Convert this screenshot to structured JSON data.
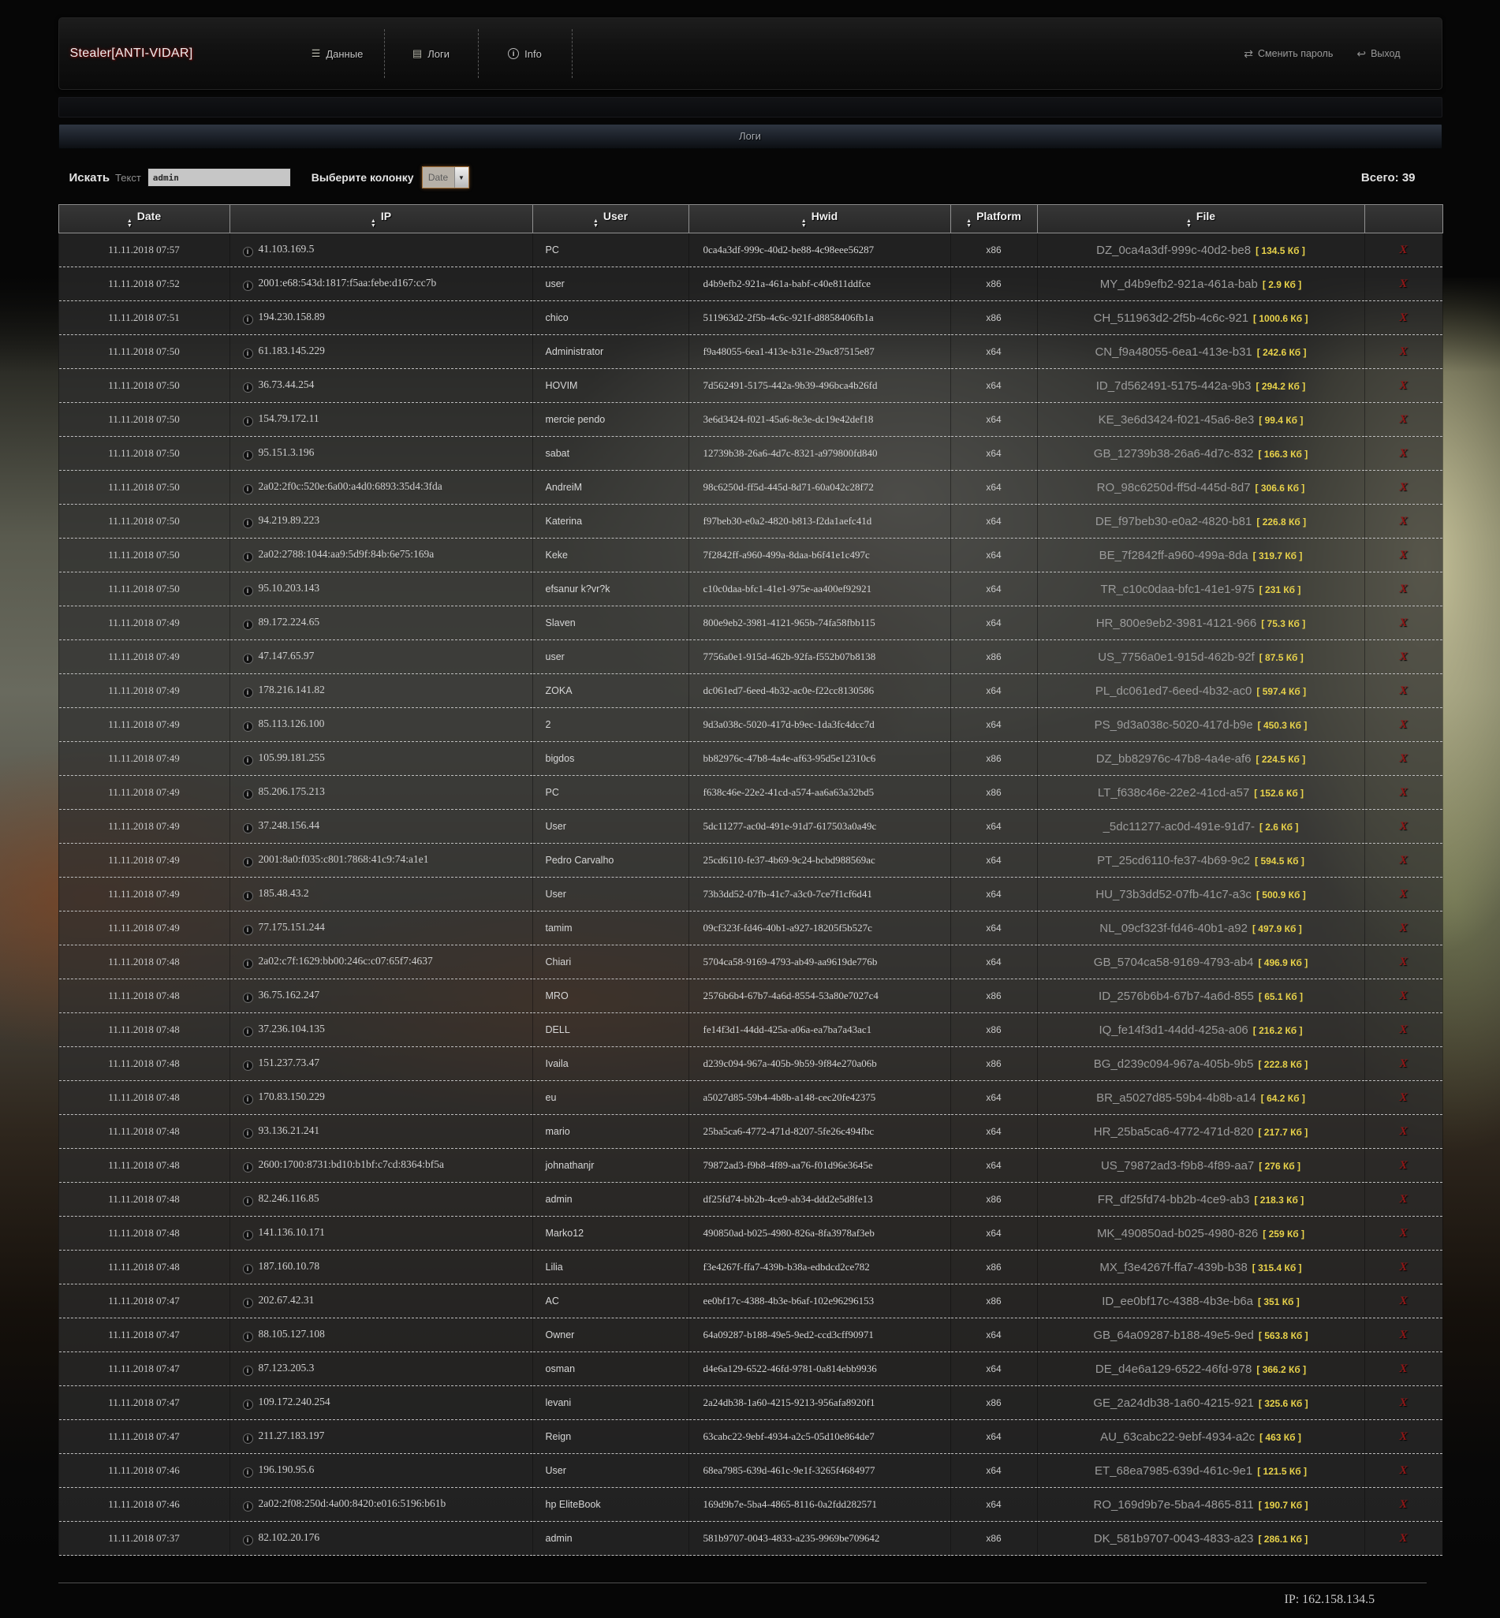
{
  "app": {
    "title": "Stealer[ANTI-VIDAR]"
  },
  "nav": {
    "items": [
      {
        "label": "Данные",
        "glyph": "☰",
        "icon": "data-menu-icon",
        "circle": false
      },
      {
        "label": "Логи",
        "glyph": "▤",
        "icon": "logs-icon",
        "circle": false
      },
      {
        "label": "Info",
        "glyph": "i",
        "icon": "info-icon",
        "circle": true
      }
    ]
  },
  "account": {
    "change_password": "Сменить пароль",
    "logout": "Выход",
    "change_password_glyph": "⇄",
    "logout_glyph": "↩"
  },
  "section": {
    "title": "Логи"
  },
  "search": {
    "label": "Искать",
    "text_label": "Текст",
    "value": "admin",
    "column_label": "Выберите колонку",
    "column_selected": "Date",
    "total_label": "Всего: 39"
  },
  "colors": {
    "title_glow": "#8a1111",
    "file_size_yellow": "#e8d24a",
    "delete_red": "#8f1717"
  },
  "footer": {
    "ip": "IP: 162.158.134.5"
  },
  "table": {
    "delete_glyph": "X",
    "columns": [
      {
        "key": "date",
        "label": "Date"
      },
      {
        "key": "ip",
        "label": "IP"
      },
      {
        "key": "user",
        "label": "User"
      },
      {
        "key": "hwid",
        "label": "Hwid"
      },
      {
        "key": "platform",
        "label": "Platform"
      },
      {
        "key": "file",
        "label": "File"
      }
    ],
    "rows": [
      {
        "date": "11.11.2018 07:57",
        "ip": "41.103.169.5",
        "user": "PC",
        "hwid": "0ca4a3df-999c-40d2-be88-4c98eee56287",
        "platform": "x86",
        "file": "DZ_0ca4a3df-999c-40d2-be8",
        "size": "134.5 Кб"
      },
      {
        "date": "11.11.2018 07:52",
        "ip": "2001:e68:543d:1817:f5aa:febe:d167:cc7b",
        "user": "user",
        "hwid": "d4b9efb2-921a-461a-babf-c40e811ddfce",
        "platform": "x86",
        "file": "MY_d4b9efb2-921a-461a-bab",
        "size": "2.9 Кб"
      },
      {
        "date": "11.11.2018 07:51",
        "ip": "194.230.158.89",
        "user": "chico",
        "hwid": "511963d2-2f5b-4c6c-921f-d8858406fb1a",
        "platform": "x86",
        "file": "CH_511963d2-2f5b-4c6c-921",
        "size": "1000.6 Кб"
      },
      {
        "date": "11.11.2018 07:50",
        "ip": "61.183.145.229",
        "user": "Administrator",
        "hwid": "f9a48055-6ea1-413e-b31e-29ac87515e87",
        "platform": "x64",
        "file": "CN_f9a48055-6ea1-413e-b31",
        "size": "242.6 Кб"
      },
      {
        "date": "11.11.2018 07:50",
        "ip": "36.73.44.254",
        "user": "HOVIM",
        "hwid": "7d562491-5175-442a-9b39-496bca4b26fd",
        "platform": "x64",
        "file": "ID_7d562491-5175-442a-9b3",
        "size": "294.2 Кб"
      },
      {
        "date": "11.11.2018 07:50",
        "ip": "154.79.172.11",
        "user": "mercie pendo",
        "hwid": "3e6d3424-f021-45a6-8e3e-dc19e42def18",
        "platform": "x64",
        "file": "KE_3e6d3424-f021-45a6-8e3",
        "size": "99.4 Кб"
      },
      {
        "date": "11.11.2018 07:50",
        "ip": "95.151.3.196",
        "user": "sabat",
        "hwid": "12739b38-26a6-4d7c-8321-a979800fd840",
        "platform": "x64",
        "file": "GB_12739b38-26a6-4d7c-832",
        "size": "166.3 Кб"
      },
      {
        "date": "11.11.2018 07:50",
        "ip": "2a02:2f0c:520e:6a00:a4d0:6893:35d4:3fda",
        "user": "AndreiM",
        "hwid": "98c6250d-ff5d-445d-8d71-60a042c28f72",
        "platform": "x64",
        "file": "RO_98c6250d-ff5d-445d-8d7",
        "size": "306.6 Кб"
      },
      {
        "date": "11.11.2018 07:50",
        "ip": "94.219.89.223",
        "user": "Katerina",
        "hwid": "f97beb30-e0a2-4820-b813-f2da1aefc41d",
        "platform": "x64",
        "file": "DE_f97beb30-e0a2-4820-b81",
        "size": "226.8 Кб"
      },
      {
        "date": "11.11.2018 07:50",
        "ip": "2a02:2788:1044:aa9:5d9f:84b:6e75:169a",
        "user": "Keke",
        "hwid": "7f2842ff-a960-499a-8daa-b6f41e1c497c",
        "platform": "x64",
        "file": "BE_7f2842ff-a960-499a-8da",
        "size": "319.7 Кб"
      },
      {
        "date": "11.11.2018 07:50",
        "ip": "95.10.203.143",
        "user": "efsanur k?vr?k",
        "hwid": "c10c0daa-bfc1-41e1-975e-aa400ef92921",
        "platform": "x64",
        "file": "TR_c10c0daa-bfc1-41e1-975",
        "size": "231 Кб"
      },
      {
        "date": "11.11.2018 07:49",
        "ip": "89.172.224.65",
        "user": "Slaven",
        "hwid": "800e9eb2-3981-4121-965b-74fa58fbb115",
        "platform": "x64",
        "file": "HR_800e9eb2-3981-4121-966",
        "size": "75.3 Кб"
      },
      {
        "date": "11.11.2018 07:49",
        "ip": "47.147.65.97",
        "user": "user",
        "hwid": "7756a0e1-915d-462b-92fa-f552b07b8138",
        "platform": "x86",
        "file": "US_7756a0e1-915d-462b-92f",
        "size": "87.5 Кб"
      },
      {
        "date": "11.11.2018 07:49",
        "ip": "178.216.141.82",
        "user": "ZOKA",
        "hwid": "dc061ed7-6eed-4b32-ac0e-f22cc8130586",
        "platform": "x64",
        "file": "PL_dc061ed7-6eed-4b32-ac0",
        "size": "597.4 Кб"
      },
      {
        "date": "11.11.2018 07:49",
        "ip": "85.113.126.100",
        "user": "2",
        "hwid": "9d3a038c-5020-417d-b9ec-1da3fc4dcc7d",
        "platform": "x64",
        "file": "PS_9d3a038c-5020-417d-b9e",
        "size": "450.3 Кб"
      },
      {
        "date": "11.11.2018 07:49",
        "ip": "105.99.181.255",
        "user": "bigdos",
        "hwid": "bb82976c-47b8-4a4e-af63-95d5e12310c6",
        "platform": "x86",
        "file": "DZ_bb82976c-47b8-4a4e-af6",
        "size": "224.5 Кб"
      },
      {
        "date": "11.11.2018 07:49",
        "ip": "85.206.175.213",
        "user": "PC",
        "hwid": "f638c46e-22e2-41cd-a574-aa6a63a32bd5",
        "platform": "x86",
        "file": "LT_f638c46e-22e2-41cd-a57",
        "size": "152.6 Кб"
      },
      {
        "date": "11.11.2018 07:49",
        "ip": "37.248.156.44",
        "user": "User",
        "hwid": "5dc11277-ac0d-491e-91d7-617503a0a49c",
        "platform": "x64",
        "file": "_5dc11277-ac0d-491e-91d7-",
        "size": "2.6 Кб"
      },
      {
        "date": "11.11.2018 07:49",
        "ip": "2001:8a0:f035:c801:7868:41c9:74:a1e1",
        "user": "Pedro Carvalho",
        "hwid": "25cd6110-fe37-4b69-9c24-bcbd988569ac",
        "platform": "x64",
        "file": "PT_25cd6110-fe37-4b69-9c2",
        "size": "594.5 Кб"
      },
      {
        "date": "11.11.2018 07:49",
        "ip": "185.48.43.2",
        "user": "User",
        "hwid": "73b3dd52-07fb-41c7-a3c0-7ce7f1cf6d41",
        "platform": "x64",
        "file": "HU_73b3dd52-07fb-41c7-a3c",
        "size": "500.9 Кб"
      },
      {
        "date": "11.11.2018 07:49",
        "ip": "77.175.151.244",
        "user": "tamim",
        "hwid": "09cf323f-fd46-40b1-a927-18205f5b527c",
        "platform": "x64",
        "file": "NL_09cf323f-fd46-40b1-a92",
        "size": "497.9 Кб"
      },
      {
        "date": "11.11.2018 07:48",
        "ip": "2a02:c7f:1629:bb00:246c:c07:65f7:4637",
        "user": "Chiari",
        "hwid": "5704ca58-9169-4793-ab49-aa9619de776b",
        "platform": "x64",
        "file": "GB_5704ca58-9169-4793-ab4",
        "size": "496.9 Кб"
      },
      {
        "date": "11.11.2018 07:48",
        "ip": "36.75.162.247",
        "user": "MRO",
        "hwid": "2576b6b4-67b7-4a6d-8554-53a80e7027c4",
        "platform": "x86",
        "file": "ID_2576b6b4-67b7-4a6d-855",
        "size": "65.1 Кб"
      },
      {
        "date": "11.11.2018 07:48",
        "ip": "37.236.104.135",
        "user": "DELL",
        "hwid": "fe14f3d1-44dd-425a-a06a-ea7ba7a43ac1",
        "platform": "x86",
        "file": "IQ_fe14f3d1-44dd-425a-a06",
        "size": "216.2 Кб"
      },
      {
        "date": "11.11.2018 07:48",
        "ip": "151.237.73.47",
        "user": "Ivaila",
        "hwid": "d239c094-967a-405b-9b59-9f84e270a06b",
        "platform": "x86",
        "file": "BG_d239c094-967a-405b-9b5",
        "size": "222.8 Кб"
      },
      {
        "date": "11.11.2018 07:48",
        "ip": "170.83.150.229",
        "user": "eu",
        "hwid": "a5027d85-59b4-4b8b-a148-cec20fe42375",
        "platform": "x64",
        "file": "BR_a5027d85-59b4-4b8b-a14",
        "size": "64.2 Кб"
      },
      {
        "date": "11.11.2018 07:48",
        "ip": "93.136.21.241",
        "user": "mario",
        "hwid": "25ba5ca6-4772-471d-8207-5fe26c494fbc",
        "platform": "x64",
        "file": "HR_25ba5ca6-4772-471d-820",
        "size": "217.7 Кб"
      },
      {
        "date": "11.11.2018 07:48",
        "ip": "2600:1700:8731:bd10:b1bf:c7cd:8364:bf5a",
        "user": "johnathanjr",
        "hwid": "79872ad3-f9b8-4f89-aa76-f01d96e3645e",
        "platform": "x64",
        "file": "US_79872ad3-f9b8-4f89-aa7",
        "size": "276 Кб"
      },
      {
        "date": "11.11.2018 07:48",
        "ip": "82.246.116.85",
        "user": "admin",
        "hwid": "df25fd74-bb2b-4ce9-ab34-ddd2e5d8fe13",
        "platform": "x86",
        "file": "FR_df25fd74-bb2b-4ce9-ab3",
        "size": "218.3 Кб"
      },
      {
        "date": "11.11.2018 07:48",
        "ip": "141.136.10.171",
        "user": "Marko12",
        "hwid": "490850ad-b025-4980-826a-8fa3978af3eb",
        "platform": "x64",
        "file": "MK_490850ad-b025-4980-826",
        "size": "259 Кб"
      },
      {
        "date": "11.11.2018 07:48",
        "ip": "187.160.10.78",
        "user": "Lilia",
        "hwid": "f3e4267f-ffa7-439b-b38a-edbdcd2ce782",
        "platform": "x86",
        "file": "MX_f3e4267f-ffa7-439b-b38",
        "size": "315.4 Кб"
      },
      {
        "date": "11.11.2018 07:47",
        "ip": "202.67.42.31",
        "user": "AC",
        "hwid": "ee0bf17c-4388-4b3e-b6af-102e96296153",
        "platform": "x86",
        "file": "ID_ee0bf17c-4388-4b3e-b6a",
        "size": "351 Кб"
      },
      {
        "date": "11.11.2018 07:47",
        "ip": "88.105.127.108",
        "user": "Owner",
        "hwid": "64a09287-b188-49e5-9ed2-ccd3cff90971",
        "platform": "x64",
        "file": "GB_64a09287-b188-49e5-9ed",
        "size": "563.8 Кб"
      },
      {
        "date": "11.11.2018 07:47",
        "ip": "87.123.205.3",
        "user": "osman",
        "hwid": "d4e6a129-6522-46fd-9781-0a814ebb9936",
        "platform": "x64",
        "file": "DE_d4e6a129-6522-46fd-978",
        "size": "366.2 Кб"
      },
      {
        "date": "11.11.2018 07:47",
        "ip": "109.172.240.254",
        "user": "levani",
        "hwid": "2a24db38-1a60-4215-9213-956afa8920f1",
        "platform": "x86",
        "file": "GE_2a24db38-1a60-4215-921",
        "size": "325.6 Кб"
      },
      {
        "date": "11.11.2018 07:47",
        "ip": "211.27.183.197",
        "user": "Reign",
        "hwid": "63cabc22-9ebf-4934-a2c5-05d10e864de7",
        "platform": "x64",
        "file": "AU_63cabc22-9ebf-4934-a2c",
        "size": "463 Кб"
      },
      {
        "date": "11.11.2018 07:46",
        "ip": "196.190.95.6",
        "user": "User",
        "hwid": "68ea7985-639d-461c-9e1f-3265f4684977",
        "platform": "x64",
        "file": "ET_68ea7985-639d-461c-9e1",
        "size": "121.5 Кб"
      },
      {
        "date": "11.11.2018 07:46",
        "ip": "2a02:2f08:250d:4a00:8420:e016:5196:b61b",
        "user": "hp EliteBook",
        "hwid": "169d9b7e-5ba4-4865-8116-0a2fdd282571",
        "platform": "x64",
        "file": "RO_169d9b7e-5ba4-4865-811",
        "size": "190.7 Кб"
      },
      {
        "date": "11.11.2018 07:37",
        "ip": "82.102.20.176",
        "user": "admin",
        "hwid": "581b9707-0043-4833-a235-9969be709642",
        "platform": "x86",
        "file": "DK_581b9707-0043-4833-a23",
        "size": "286.1 Кб"
      }
    ]
  }
}
